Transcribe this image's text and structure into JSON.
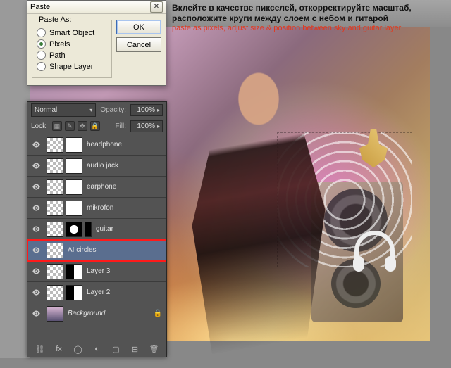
{
  "dialog": {
    "title": "Paste",
    "groupbox_title": "Paste As:",
    "options": {
      "smart_object": "Smart Object",
      "pixels": "Pixels",
      "path": "Path",
      "shape_layer": "Shape Layer"
    },
    "selected": "pixels",
    "ok": "OK",
    "cancel": "Cancel"
  },
  "instructions": {
    "line1": "Вклейте в качестве пикселей, откорректируйте масштаб,",
    "line2": "расположите круги между слоем с небом и гитарой",
    "line3": "paste as pixels, adjust size & position between sky and guitar layer"
  },
  "layers_panel": {
    "blend_mode": "Normal",
    "opacity_label": "Opacity:",
    "opacity_value": "100%",
    "lock_label": "Lock:",
    "fill_label": "Fill:",
    "fill_value": "100%",
    "layers": [
      {
        "name": "headphone",
        "masked": true
      },
      {
        "name": "audio jack",
        "masked": true
      },
      {
        "name": "earphone",
        "masked": true
      },
      {
        "name": "mikrofon",
        "masked": true
      },
      {
        "name": "guitar",
        "masked": true,
        "small_extra": true
      },
      {
        "name": "AI circles",
        "selected": true,
        "highlight": true
      },
      {
        "name": "Layer 3",
        "masked": true,
        "gradient_mask": true
      },
      {
        "name": "Layer 2",
        "masked": true,
        "gradient_mask": true
      },
      {
        "name": "Background",
        "bg": true,
        "locked": true
      }
    ],
    "footer_icons": [
      "link",
      "fx",
      "mask",
      "adjust",
      "folder",
      "new",
      "trash"
    ]
  }
}
